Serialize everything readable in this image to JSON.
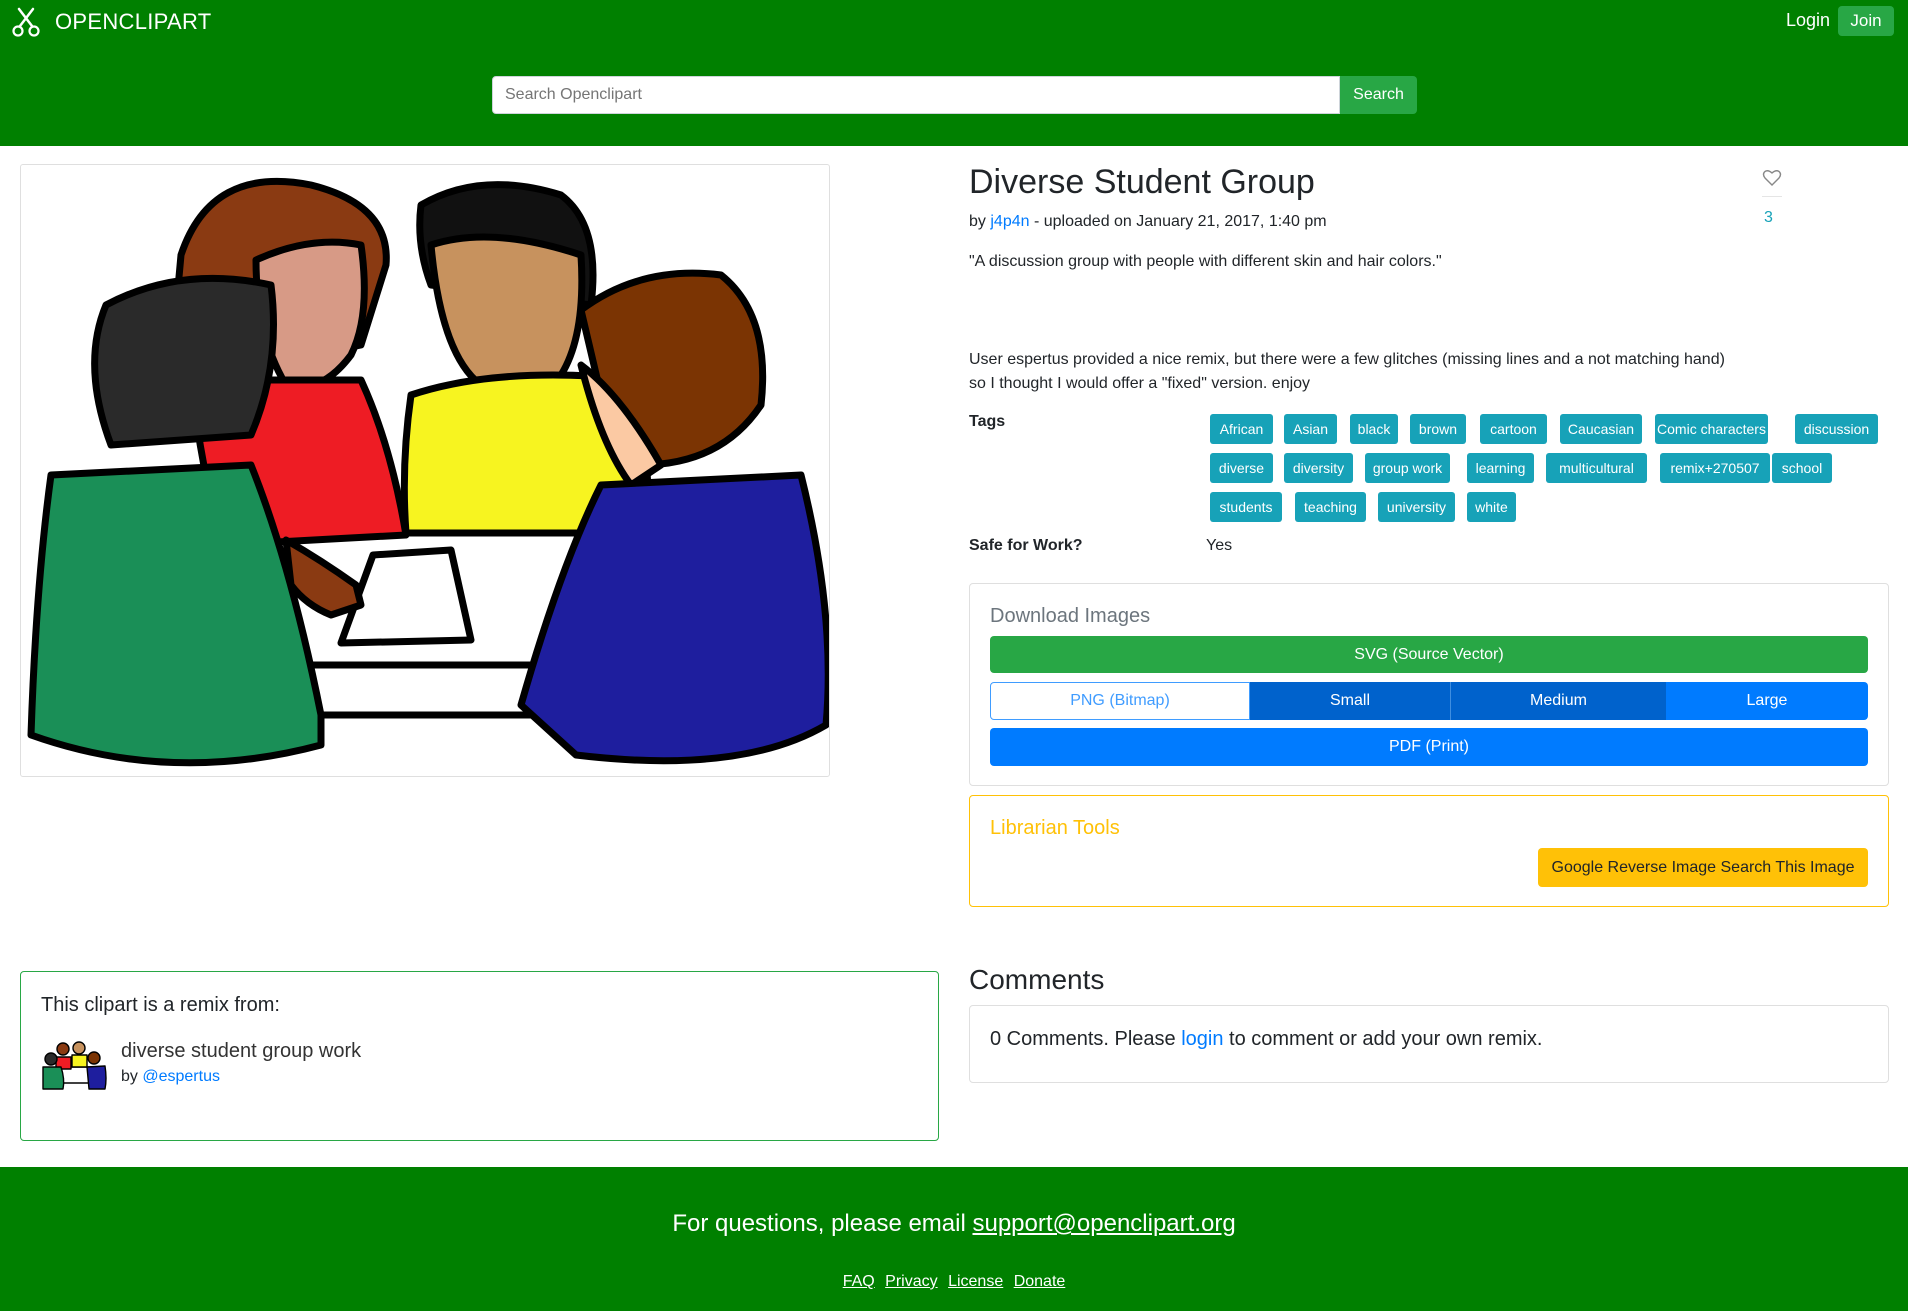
{
  "header": {
    "brand": "OPENCLIPART",
    "login": "Login",
    "join": "Join",
    "search_placeholder": "Search Openclipart",
    "search_button": "Search"
  },
  "clipart": {
    "title": "Diverse Student Group",
    "by_prefix": "by",
    "author": "j4p4n",
    "uploaded": "- uploaded on January 21, 2017, 1:40 pm",
    "likes": "3",
    "quote": "\"A discussion group with people with different skin and hair colors.\"",
    "description_line1": "User espertus provided a nice remix, but there were a few glitches (missing lines and a not matching hand)",
    "description_line2": "so I thought I would offer a \"fixed\" version. enjoy",
    "tags_label": "Tags",
    "tags": [
      "African",
      "Asian",
      "black",
      "brown",
      "cartoon",
      "Caucasian",
      "Comic characters",
      "discussion",
      "diverse",
      "diversity",
      "group work",
      "learning",
      "multicultural",
      "remix+270507",
      "school",
      "students",
      "teaching",
      "university",
      "white"
    ],
    "sfw_label": "Safe for Work?",
    "sfw_value": "Yes"
  },
  "download": {
    "title": "Download Images",
    "svg": "SVG (Source Vector)",
    "png": "PNG (Bitmap)",
    "small": "Small",
    "medium": "Medium",
    "large": "Large",
    "pdf": "PDF (Print)"
  },
  "librarian": {
    "title": "Librarian Tools",
    "button": "Google Reverse Image Search This Image"
  },
  "remix": {
    "heading": "This clipart is a remix from:",
    "name": "diverse student group work",
    "by_prefix": "by",
    "author": "@espertus"
  },
  "comments": {
    "title": "Comments",
    "text_before": "0 Comments. Please",
    "login_link": "login",
    "text_after": "to comment or add your own remix."
  },
  "footer": {
    "message": "For questions, please email",
    "email": "support@openclipart.org",
    "links": [
      "FAQ",
      "Privacy",
      "License",
      "Donate"
    ]
  },
  "colors": {
    "brand_green": "#008000",
    "success": "#28a745",
    "primary": "#007bff",
    "info": "#17a2b8",
    "warning": "#ffc107"
  }
}
